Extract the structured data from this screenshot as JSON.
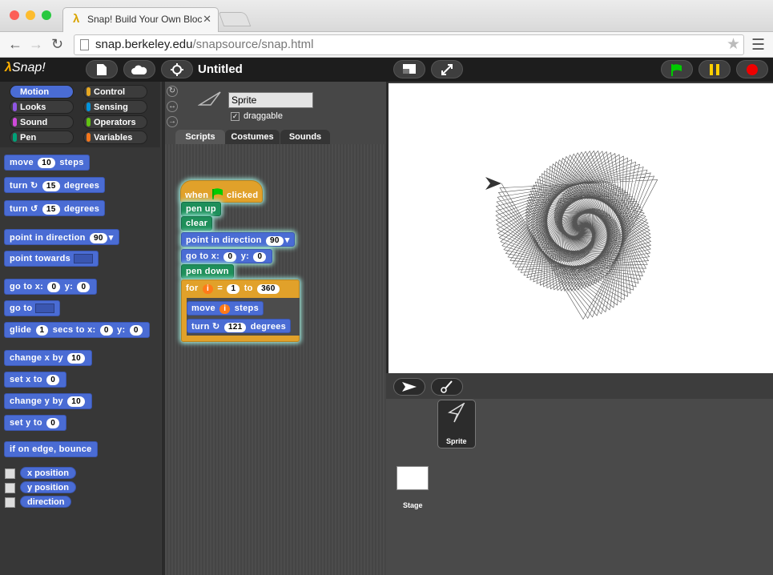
{
  "browser": {
    "tab_title": "Snap! Build Your Own Bloc",
    "close": "✕",
    "url_domain": "snap.berkeley.edu",
    "url_path": "/snapsource/snap.html",
    "lambda": "λ"
  },
  "snap": {
    "logo_lambda": "λ",
    "logo_text": "Snap!",
    "project_title": "Untitled",
    "categories": [
      "Motion",
      "Looks",
      "Sound",
      "Pen",
      "Control",
      "Sensing",
      "Operators",
      "Variables"
    ],
    "category_colors": [
      "#4a6cd4",
      "#8f56e3",
      "#cf4ad9",
      "#00a178",
      "#e6a822",
      "#0494dc",
      "#62c213",
      "#f3761d"
    ],
    "palette": {
      "move": "move",
      "move_val": "10",
      "steps": "steps",
      "turn": "turn",
      "turn_cw_val": "15",
      "degrees": "degrees",
      "turn_ccw_val": "15",
      "point_in_direction": "point in direction",
      "point_dir_val": "90",
      "point_towards": "point towards",
      "go_to_xy": "go to x:",
      "x_val": "0",
      "y_lbl": "y:",
      "y_val": "0",
      "go_to": "go to",
      "glide": "glide",
      "glide_val": "1",
      "secs_to_x": "secs to x:",
      "glide_x": "0",
      "glide_y": "0",
      "change_x_by": "change x by",
      "change_x_val": "10",
      "set_x_to": "set x to",
      "set_x_val": "0",
      "change_y_by": "change y by",
      "change_y_val": "10",
      "set_y_to": "set y to",
      "set_y_val": "0",
      "bounce": "if on edge, bounce",
      "x_position": "x position",
      "y_position": "y position",
      "direction": "direction"
    },
    "sprite": {
      "name": "Sprite",
      "draggable": "draggable",
      "check": "✓",
      "tabs": [
        "Scripts",
        "Costumes",
        "Sounds"
      ]
    },
    "script": {
      "when": "when",
      "clicked": "clicked",
      "pen_up": "pen up",
      "clear": "clear",
      "point_in_direction": "point in direction",
      "dir_val": "90",
      "go_to_x": "go to x:",
      "x_val": "0",
      "y_lbl": "y:",
      "y_val": "0",
      "pen_down": "pen down",
      "for": "for",
      "var_i": "i",
      "eq": "=",
      "from": "1",
      "to": "to",
      "to_val": "360",
      "move": "move",
      "steps": "steps",
      "turn": "turn",
      "turn_val": "121",
      "degrees": "degrees"
    },
    "corral": {
      "sprite_label": "Sprite",
      "stage_label": "Stage"
    }
  }
}
